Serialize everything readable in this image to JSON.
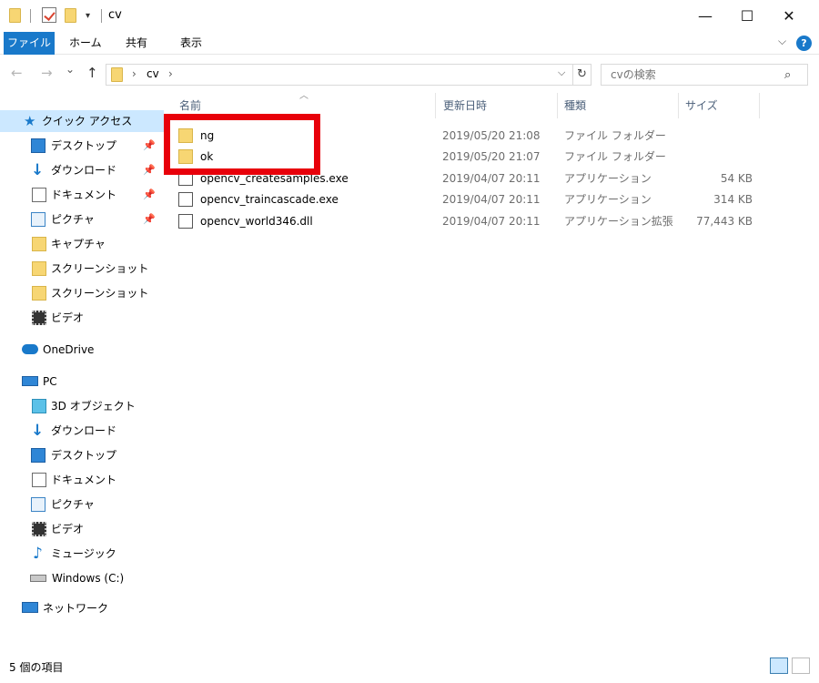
{
  "window": {
    "title": "cv",
    "minimize": "—",
    "maximize": "☐",
    "close": "✕"
  },
  "ribbon": {
    "tabs": [
      "ファイル",
      "ホーム",
      "共有",
      "表示"
    ],
    "help": "?"
  },
  "nav": {
    "back": "←",
    "forward": "→",
    "recent": "⌄",
    "up": "↑",
    "breadcrumb": [
      "cv"
    ],
    "search_placeholder": "cvの検索"
  },
  "sidebar": {
    "quick_access": "クイック アクセス",
    "quick_items": [
      "デスクトップ",
      "ダウンロード",
      "ドキュメント",
      "ピクチャ",
      "キャプチャ",
      "スクリーンショット",
      "スクリーンショット",
      "ビデオ"
    ],
    "onedrive": "OneDrive",
    "pc": "PC",
    "pc_items": [
      "3D オブジェクト",
      "ダウンロード",
      "デスクトップ",
      "ドキュメント",
      "ピクチャ",
      "ビデオ",
      "ミュージック",
      "Windows (C:)"
    ],
    "network": "ネットワーク"
  },
  "columns": {
    "name": "名前",
    "modified": "更新日時",
    "type": "種類",
    "size": "サイズ"
  },
  "files": [
    {
      "name": "ng",
      "date": "2019/05/20 21:08",
      "type": "ファイル フォルダー",
      "size": ""
    },
    {
      "name": "ok",
      "date": "2019/05/20 21:07",
      "type": "ファイル フォルダー",
      "size": ""
    },
    {
      "name": "opencv_createsamples.exe",
      "date": "2019/04/07 20:11",
      "type": "アプリケーション",
      "size": "54 KB"
    },
    {
      "name": "opencv_traincascade.exe",
      "date": "2019/04/07 20:11",
      "type": "アプリケーション",
      "size": "314 KB"
    },
    {
      "name": "opencv_world346.dll",
      "date": "2019/04/07 20:11",
      "type": "アプリケーション拡張",
      "size": "77,443 KB"
    }
  ],
  "status": {
    "count": "5 個の項目"
  },
  "colors": {
    "accent": "#1979ca",
    "selection": "#cce8ff",
    "highlight_box": "#e8000a",
    "folder": "#f7d673"
  }
}
